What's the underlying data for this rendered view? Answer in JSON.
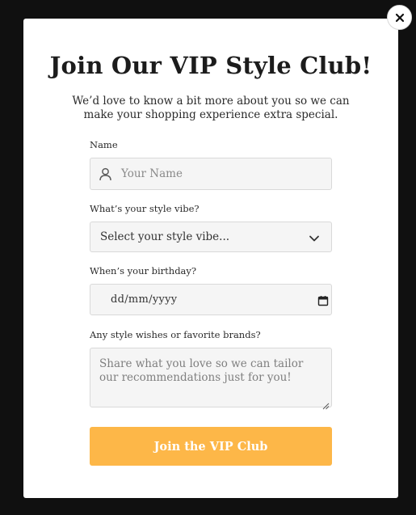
{
  "modal": {
    "title": "Join Our VIP Style Club!",
    "subtitle": "We’d love to know a bit more about you so we can make your shopping experience extra special."
  },
  "form": {
    "name": {
      "label": "Name",
      "placeholder": "Your Name",
      "icon": "user-icon"
    },
    "style_vibe": {
      "label": "What’s your style vibe?",
      "selected": "Select your style vibe...",
      "icon": "chevron-down-icon"
    },
    "birthday": {
      "label": "When’s your birthday?",
      "value": "dd/mm/yyyy",
      "icon": "calendar-icon"
    },
    "wishes": {
      "label": "Any style wishes or favorite brands?",
      "placeholder": "Share what you love so we can tailor our recommendations just for you!"
    },
    "submit_label": "Join the VIP Club"
  },
  "close": {
    "icon": "close-icon"
  },
  "colors": {
    "overlay": "#101010",
    "modal_bg": "#ffffff",
    "field_bg": "#f5f5f5",
    "accent": "#fdb748",
    "text": "#1c1c1c"
  }
}
